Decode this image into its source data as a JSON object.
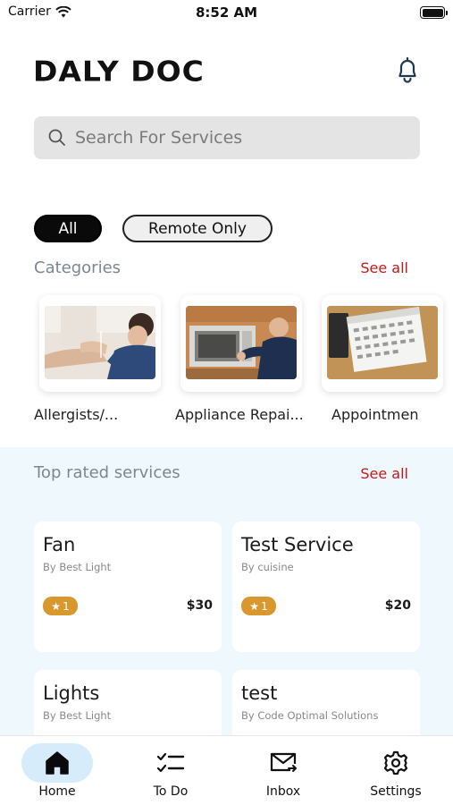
{
  "status_bar": {
    "carrier": "Carrier",
    "time": "8:52 AM"
  },
  "header": {
    "logo": "DALY DOC",
    "bell_icon": "bell-icon"
  },
  "search": {
    "placeholder": "Search For Services",
    "icon": "search-icon"
  },
  "filters": [
    {
      "label": "All",
      "selected": true
    },
    {
      "label": "Remote Only",
      "selected": false
    }
  ],
  "categories": {
    "title": "Categories",
    "see_all": "See all",
    "items": [
      {
        "label": "Allergists/..."
      },
      {
        "label": "Appliance Repai..."
      },
      {
        "label": "Appointmen"
      }
    ]
  },
  "top_rated": {
    "title": "Top rated services",
    "see_all": "See all",
    "items": [
      {
        "title": "Fan",
        "by": "By Best Light",
        "rating": "1",
        "price": "$30"
      },
      {
        "title": "Test Service",
        "by": "By cuisine",
        "rating": "1",
        "price": "$20"
      },
      {
        "title": "Lights",
        "by": "By Best Light"
      },
      {
        "title": "test",
        "by": "By Code Optimal Solutions"
      }
    ]
  },
  "tabbar": [
    {
      "label": "Home",
      "icon": "home-icon",
      "active": true
    },
    {
      "label": "To Do",
      "icon": "todo-list-icon",
      "active": false
    },
    {
      "label": "Inbox",
      "icon": "inbox-icon",
      "active": false
    },
    {
      "label": "Settings",
      "icon": "gear-icon",
      "active": false
    }
  ],
  "colors": {
    "accent_red": "#c41a1a",
    "rating_gold": "#d9982d",
    "section_bg": "#eef8fd",
    "active_tab_bg": "#d6ecfb"
  }
}
